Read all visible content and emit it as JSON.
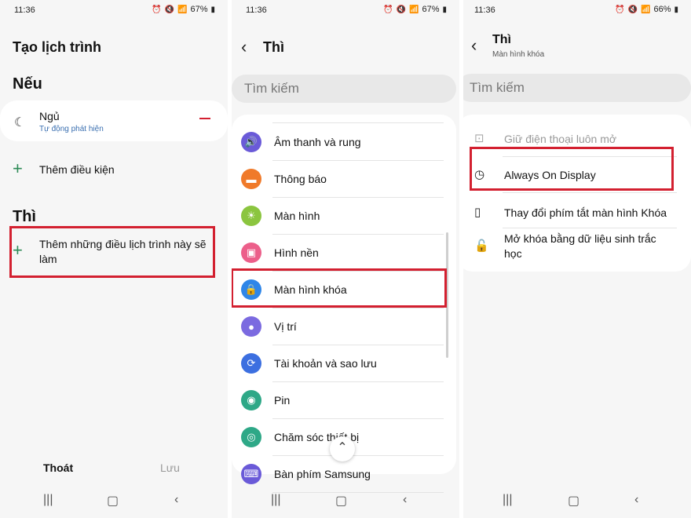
{
  "colors": {
    "accent_red": "#d32030",
    "plus_green": "#2e8b57",
    "link_blue": "#3a6fb0"
  },
  "screen1": {
    "status": {
      "time": "11:36",
      "battery": "67%"
    },
    "title": "Tạo lịch trình",
    "if_heading": "Nếu",
    "condition": {
      "label": "Ngủ",
      "sub": "Tự động phát hiện",
      "icon": "moon-icon"
    },
    "add_condition": "Thêm điều kiện",
    "then_heading": "Thì",
    "add_action": "Thêm những điều lịch trình này sẽ làm",
    "exit_button": "Thoát",
    "save_button": "Lưu"
  },
  "screen2": {
    "status": {
      "time": "11:36",
      "battery": "67%"
    },
    "title": "Thì",
    "search_placeholder": "Tìm kiếm",
    "items": [
      {
        "label": "Âm thanh và rung",
        "icon": "sound-icon",
        "color": "#6a5ad8"
      },
      {
        "label": "Thông báo",
        "icon": "notification-icon",
        "color": "#f07a2a"
      },
      {
        "label": "Màn hình",
        "icon": "brightness-icon",
        "color": "#8bc53f"
      },
      {
        "label": "Hình nền",
        "icon": "wallpaper-icon",
        "color": "#ec5f8a"
      },
      {
        "label": "Màn hình khóa",
        "icon": "lock-icon",
        "color": "#2f86e8"
      },
      {
        "label": "Vị trí",
        "icon": "location-icon",
        "color": "#7b6ae0"
      },
      {
        "label": "Tài khoản và sao lưu",
        "icon": "sync-icon",
        "color": "#3c6fe0"
      },
      {
        "label": "Pin",
        "icon": "battery-icon",
        "color": "#2ea887"
      },
      {
        "label": "Chăm sóc thiết bị",
        "icon": "device-care-icon",
        "color": "#2ea887"
      },
      {
        "label": "Bàn phím Samsung",
        "icon": "keyboard-icon",
        "color": "#6a5ad8"
      }
    ]
  },
  "screen3": {
    "status": {
      "time": "11:36",
      "battery": "66%"
    },
    "title": "Thì",
    "subtitle": "Màn hình khóa",
    "search_placeholder": "Tìm kiếm",
    "items": [
      {
        "label": "Giữ điện thoại luôn mở",
        "icon": "phone-lock-icon",
        "disabled": true
      },
      {
        "label": "Always On Display",
        "icon": "clock-icon",
        "disabled": false
      },
      {
        "label": "Thay đổi phím tắt màn hình Khóa",
        "icon": "shortcut-icon",
        "disabled": false
      },
      {
        "label": "Mở khóa bằng dữ liệu sinh trắc học",
        "icon": "unlock-icon",
        "disabled": false
      }
    ]
  }
}
